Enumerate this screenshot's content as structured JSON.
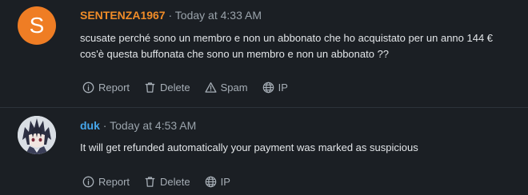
{
  "comments": [
    {
      "avatar_letter": "S",
      "author": "SENTENZA1967",
      "separator": "·",
      "time": "Today at 4:33 AM",
      "lines": [
        "scusate perché sono un membro e non un abbonato che ho acquistato per un anno 144 €",
        "cos'è questa buffonata che sono un membro e non un abbonato ??"
      ],
      "actions": {
        "report": "Report",
        "delete": "Delete",
        "spam": "Spam",
        "ip": "IP"
      }
    },
    {
      "author": "duk",
      "separator": "·",
      "time": "Today at 4:53 AM",
      "lines": [
        "It will get refunded automatically your payment was marked as suspicious"
      ],
      "actions": {
        "report": "Report",
        "delete": "Delete",
        "ip": "IP"
      }
    }
  ],
  "colors": {
    "background": "#1b1f24",
    "author_1": "#f08c28",
    "author_2": "#46a6ea",
    "avatar_1": "#ef7d24",
    "text": "#e2e5e8",
    "muted": "#9aa3ab"
  },
  "icons": {
    "report": "info-circle-icon",
    "delete": "trash-icon",
    "spam": "warning-triangle-icon",
    "ip": "globe-icon"
  }
}
